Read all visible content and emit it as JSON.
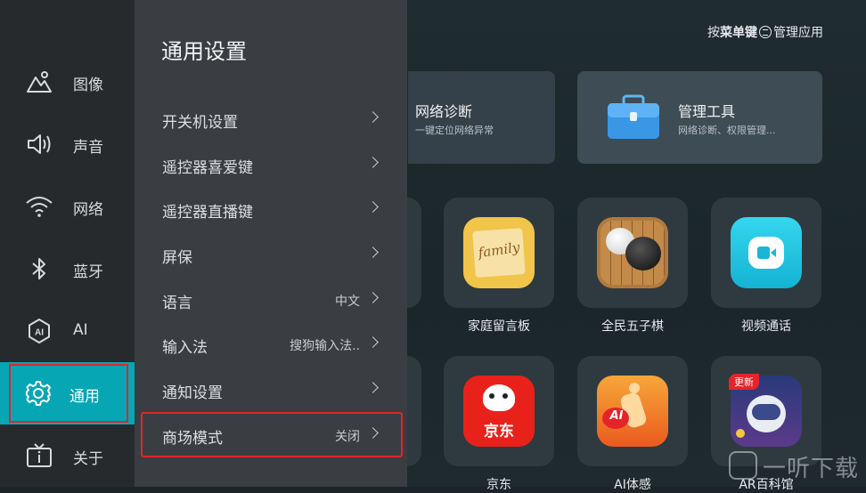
{
  "header": {
    "hint_prefix": "按",
    "hint_key": "菜单键",
    "hint_suffix": "管理应用"
  },
  "cards": [
    {
      "title": "网络诊断",
      "subtitle": "一键定位网络异常"
    },
    {
      "title": "管理工具",
      "subtitle": "网络诊断、权限管理..."
    }
  ],
  "apps": [
    {
      "label": "家庭留言板",
      "icon_text": "family"
    },
    {
      "label": "全民五子棋"
    },
    {
      "label": "视频通话"
    },
    {
      "label": "京东",
      "icon_text": "京东"
    },
    {
      "label": "AI体感",
      "icon_text": "AI"
    },
    {
      "label": "AR百科馆",
      "badge": "更新"
    }
  ],
  "nav": {
    "items": [
      {
        "label": "图像",
        "icon": "image-icon"
      },
      {
        "label": "声音",
        "icon": "speaker-icon"
      },
      {
        "label": "网络",
        "icon": "wifi-icon"
      },
      {
        "label": "蓝牙",
        "icon": "bluetooth-icon"
      },
      {
        "label": "AI",
        "icon": "ai-icon"
      },
      {
        "label": "通用",
        "icon": "gear-icon",
        "active": true
      },
      {
        "label": "关于",
        "icon": "tv-info-icon"
      }
    ]
  },
  "panel": {
    "title": "通用设置",
    "rows": [
      {
        "label": "开关机设置",
        "value": ""
      },
      {
        "label": "遥控器喜爱键",
        "value": ""
      },
      {
        "label": "遥控器直播键",
        "value": ""
      },
      {
        "label": "屏保",
        "value": ""
      },
      {
        "label": "语言",
        "value": "中文"
      },
      {
        "label": "输入法",
        "value": "搜狗输入法.."
      },
      {
        "label": "通知设置",
        "value": ""
      },
      {
        "label": "商场模式",
        "value": "关闭"
      }
    ]
  },
  "watermark": "一听下载",
  "colors": {
    "accent": "#06a6b5",
    "highlight_border": "#e0252a"
  }
}
